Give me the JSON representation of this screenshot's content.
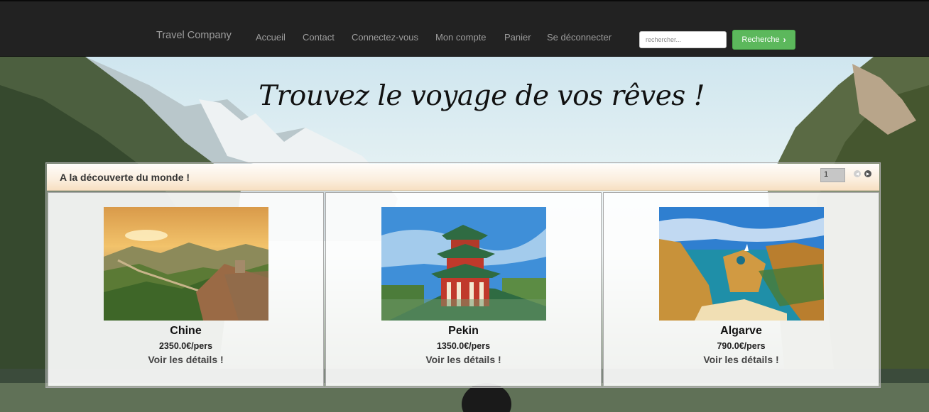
{
  "navbar": {
    "brand": "Travel Company",
    "links": [
      "Accueil",
      "Contact",
      "Connectez-vous",
      "Mon compte",
      "Panier",
      "Se déconnecter"
    ],
    "search": {
      "placeholder": "rechercher...",
      "button_label": "Recherche"
    }
  },
  "hero": {
    "title": "Trouvez le voyage de vos rêves !"
  },
  "panel": {
    "title": "A la découverte du monde !",
    "page": "1",
    "cards": [
      {
        "name": "Chine",
        "price": "2350.0€/pers",
        "details_label": "Voir les détails !",
        "image": "great-wall-image"
      },
      {
        "name": "Pekin",
        "price": "1350.0€/pers",
        "details_label": "Voir les détails !",
        "image": "pagoda-image"
      },
      {
        "name": "Algarve",
        "price": "790.0€/pers",
        "details_label": "Voir les détails !",
        "image": "coastal-cliffs-image"
      }
    ]
  },
  "colors": {
    "navbar_bg": "#222222",
    "search_button": "#5cb85c"
  }
}
